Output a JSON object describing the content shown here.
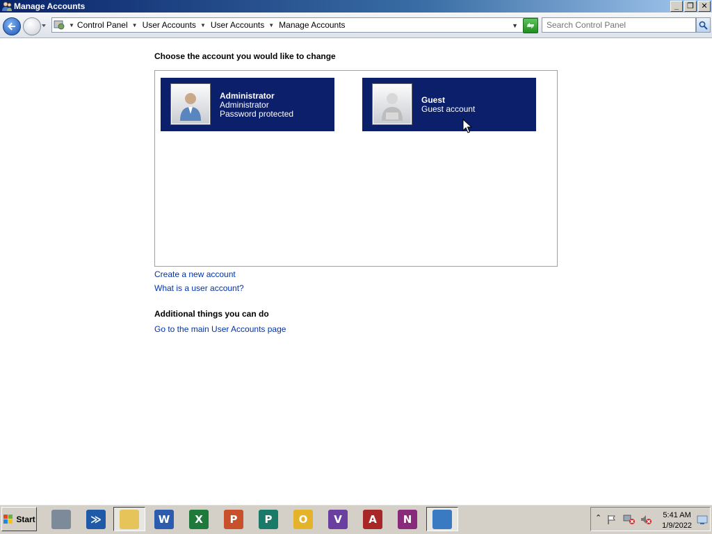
{
  "window": {
    "title": "Manage Accounts",
    "minimize": "_",
    "restore": "❐",
    "close": "✕"
  },
  "addressbar": {
    "crumbs": [
      "Control Panel",
      "User Accounts",
      "User Accounts",
      "Manage Accounts"
    ],
    "search_placeholder": "Search Control Panel"
  },
  "main": {
    "heading": "Choose the account you would like to change",
    "accounts": [
      {
        "name": "Administrator",
        "type": "Administrator",
        "status": "Password protected"
      },
      {
        "name": "Guest",
        "type": "Guest account"
      }
    ],
    "links": [
      "Create a new account",
      "What is a user account?"
    ],
    "additional_heading": "Additional things you can do",
    "additional_links": [
      "Go to the main User Accounts page"
    ]
  },
  "taskbar": {
    "start_label": "Start",
    "apps": [
      {
        "icon": "server-manager-icon",
        "color": "#7c8a99",
        "glyph": ""
      },
      {
        "icon": "powershell-icon",
        "color": "#1e5aa8",
        "glyph": "≫"
      },
      {
        "icon": "file-explorer-icon",
        "color": "#e7c45a",
        "glyph": ""
      },
      {
        "icon": "word-icon",
        "color": "#2b5cae",
        "glyph": "W"
      },
      {
        "icon": "excel-icon",
        "color": "#1e7a3a",
        "glyph": "X"
      },
      {
        "icon": "powerpoint-icon",
        "color": "#c8502a",
        "glyph": "P"
      },
      {
        "icon": "publisher-icon",
        "color": "#1a7a6a",
        "glyph": "P"
      },
      {
        "icon": "outlook-icon",
        "color": "#e5b32a",
        "glyph": "O"
      },
      {
        "icon": "visio-icon",
        "color": "#6a3fa0",
        "glyph": "V"
      },
      {
        "icon": "access-icon",
        "color": "#a82828",
        "glyph": "A"
      },
      {
        "icon": "onenote-icon",
        "color": "#8a2a7a",
        "glyph": "N"
      },
      {
        "icon": "control-panel-icon",
        "color": "#3a7ac2",
        "glyph": ""
      }
    ],
    "clock_time": "5:41 AM",
    "clock_date": "1/9/2022"
  }
}
